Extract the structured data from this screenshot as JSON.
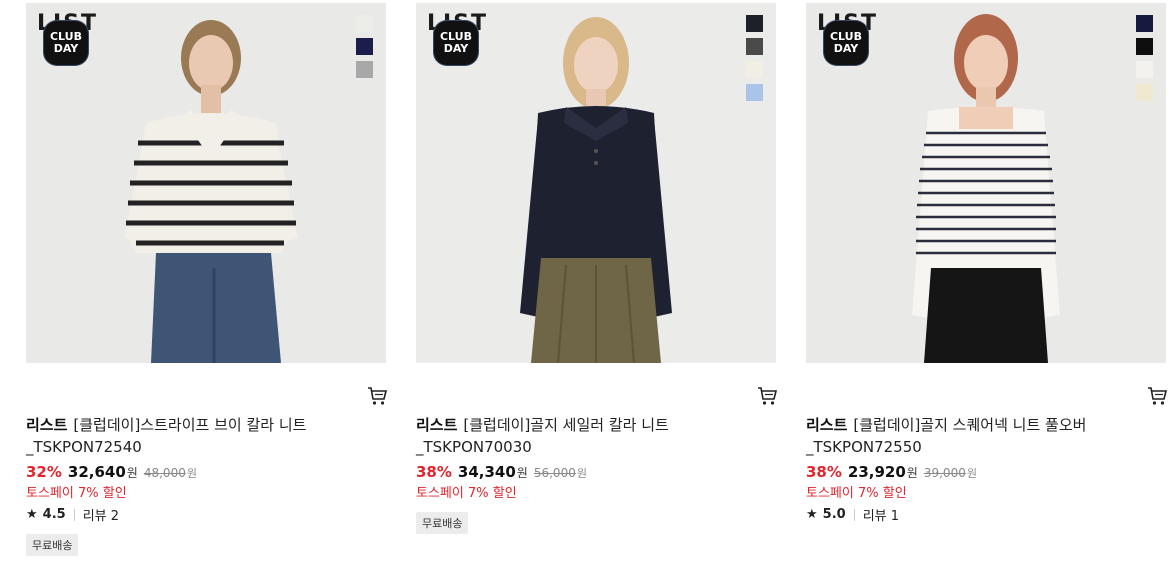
{
  "products": [
    {
      "brand_logo": "LIST",
      "badge": [
        "CLUB",
        "DAY"
      ],
      "swatches": [
        "#ecece8",
        "#1b1d4d",
        "#a8a8a8"
      ],
      "brand": "리스트",
      "name": "[클럽데이]스트라이프 브이 칼라 니트",
      "code": "_TSKPON72540",
      "discount": "32%",
      "price": "32,640",
      "price_unit": "원",
      "original_price": "48,000",
      "original_unit": "원",
      "promo": "토스페이 7% 할인",
      "rating": "4.5",
      "reviews": "리뷰 2",
      "shipping": "무료배송"
    },
    {
      "brand_logo": "LIST",
      "badge": [
        "CLUB",
        "DAY"
      ],
      "swatches": [
        "#1e2028",
        "#4a4a4a",
        "#f1efe4",
        "#a9c4e8"
      ],
      "brand": "리스트",
      "name": "[클럽데이]골지 세일러 칼라 니트",
      "code": "_TSKPON70030",
      "discount": "38%",
      "price": "34,340",
      "price_unit": "원",
      "original_price": "56,000",
      "original_unit": "원",
      "promo": "토스페이 7% 할인",
      "rating": "",
      "reviews": "",
      "shipping": "무료배송"
    },
    {
      "brand_logo": "LIST",
      "badge": [
        "CLUB",
        "DAY"
      ],
      "swatches": [
        "#161a3f",
        "#0e0e0e",
        "#f3f2ee",
        "#f0e8cf"
      ],
      "brand": "리스트",
      "name": "[클럽데이]골지 스퀘어넥 니트 풀오버",
      "code": "_TSKPON72550",
      "discount": "38%",
      "price": "23,920",
      "price_unit": "원",
      "original_price": "39,000",
      "original_unit": "원",
      "promo": "토스페이 7% 할인",
      "rating": "5.0",
      "reviews": "리뷰 1",
      "shipping": ""
    }
  ]
}
